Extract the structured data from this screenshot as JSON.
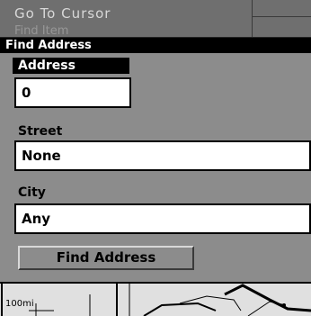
{
  "background_menu": {
    "item_label": "Go To Cursor"
  },
  "dialog": {
    "title": "Find Address",
    "address": {
      "label": "Address",
      "value": "0"
    },
    "street": {
      "label": "Street",
      "value": "None"
    },
    "city": {
      "label": "City",
      "value": "Any"
    },
    "find_button_label": "Find Address"
  },
  "map": {
    "scale_label": "100mi"
  }
}
